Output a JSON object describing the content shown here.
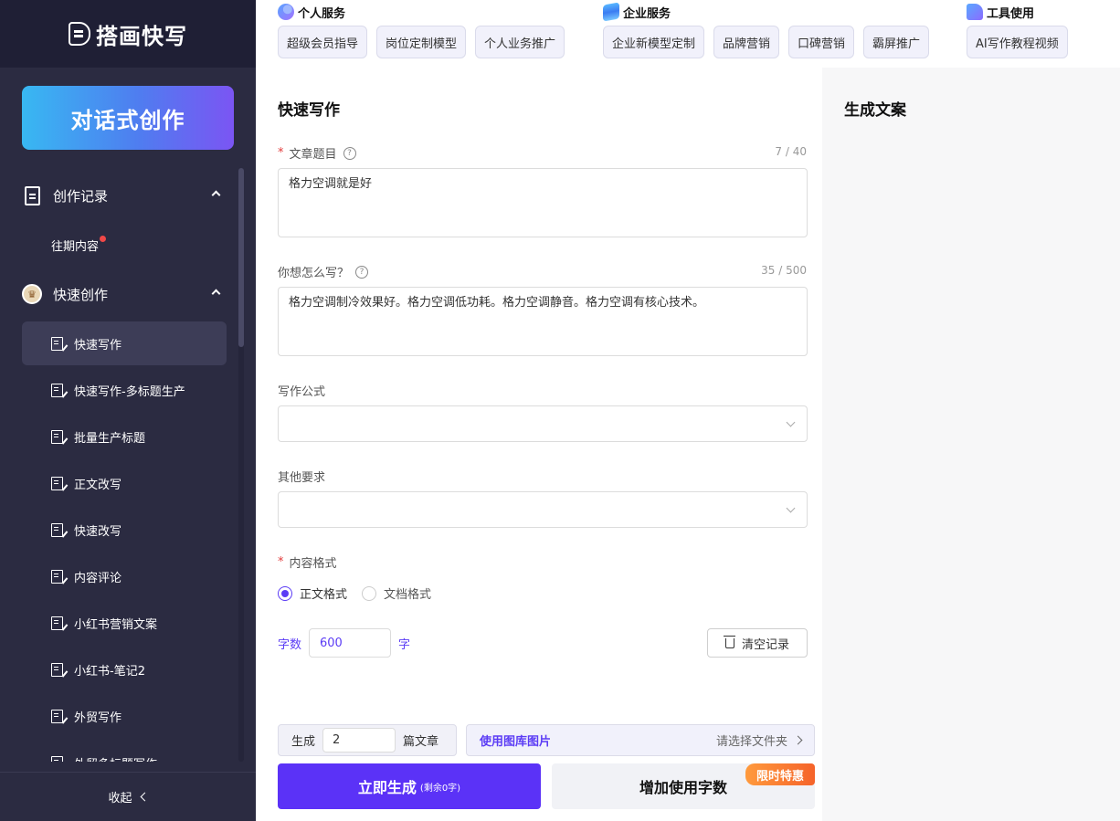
{
  "app": {
    "logo_text": "搭画快写"
  },
  "sidebar": {
    "chat_button": "对话式创作",
    "groups": [
      {
        "title": "创作记录",
        "icon": "document-icon",
        "items": [
          {
            "label": "往期内容",
            "badge": true
          }
        ]
      },
      {
        "title": "快速创作",
        "icon": "crown-icon",
        "items": [
          {
            "label": "快速写作",
            "active": true
          },
          {
            "label": "快速写作-多标题生产"
          },
          {
            "label": "批量生产标题"
          },
          {
            "label": "正文改写"
          },
          {
            "label": "快速改写"
          },
          {
            "label": "内容评论"
          },
          {
            "label": "小红书营销文案"
          },
          {
            "label": "小红书-笔记2"
          },
          {
            "label": "外贸写作"
          },
          {
            "label": "外贸多标题写作"
          }
        ]
      }
    ],
    "collapse_label": "收起"
  },
  "topnav": {
    "groups": [
      {
        "title": "个人服务",
        "icon": "person-service-icon",
        "tags": [
          "超级会员指导",
          "岗位定制模型",
          "个人业务推广"
        ]
      },
      {
        "title": "企业服务",
        "icon": "enterprise-stack-icon",
        "tags": [
          "企业新模型定制",
          "品牌营销",
          "口碑营销",
          "霸屏推广"
        ]
      },
      {
        "title": "工具使用",
        "icon": "tools-icon",
        "tags": [
          "AI写作教程视频"
        ]
      }
    ]
  },
  "form": {
    "title": "快速写作",
    "article_title": {
      "label": "文章题目",
      "value": "格力空调就是好",
      "counter": "7 / 40"
    },
    "how_to_write": {
      "label": "你想怎么写？",
      "value": "格力空调制冷效果好。格力空调低功耗。格力空调静音。格力空调有核心技术。",
      "counter": "35 / 500"
    },
    "formula": {
      "label": "写作公式",
      "value": ""
    },
    "other": {
      "label": "其他要求",
      "value": ""
    },
    "content_format": {
      "label": "内容格式",
      "options": [
        "正文格式",
        "文档格式"
      ],
      "selected": "正文格式"
    },
    "word_count": {
      "label": "字数",
      "value": "600",
      "unit": "字"
    },
    "clear_button": "清空记录"
  },
  "bottom": {
    "generate_label": "生成",
    "generate_count": "2",
    "generate_unit": "篇文章",
    "library_label": "使用图库图片",
    "library_action": "请选择文件夹",
    "primary_button": "立即生成",
    "primary_note": "(剩余0字)",
    "secondary_button": "增加使用字数",
    "promo_badge": "限时特惠"
  },
  "output": {
    "title": "生成文案"
  },
  "colors": {
    "accent": "#5b32f7",
    "sidebar_bg": "#2b2b41",
    "logo_bg": "#1f1f35",
    "promo": "#f5632a"
  }
}
